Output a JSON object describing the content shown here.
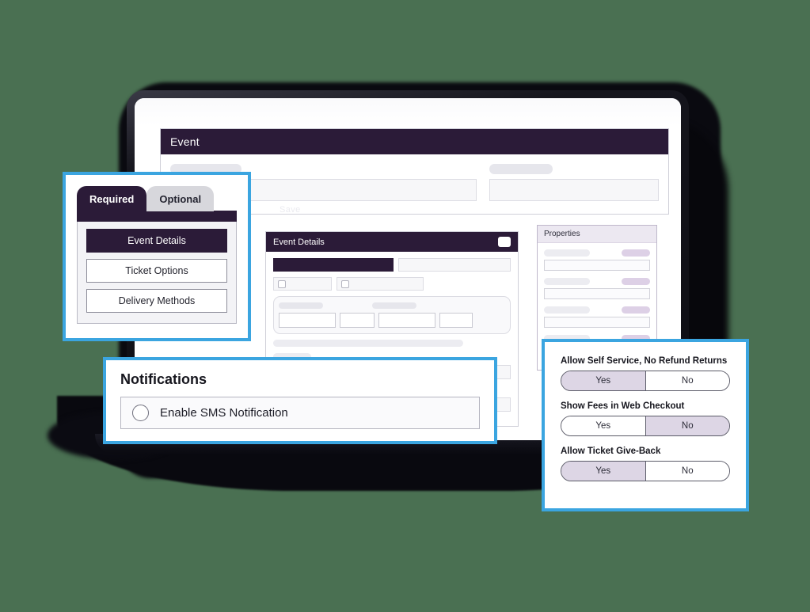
{
  "theme": {
    "background": "#4a7052",
    "accent_blue": "#3ba5e0",
    "brand_purple": "#2b1b38",
    "toggle_selected": "#ddd6e5"
  },
  "app": {
    "event_card": {
      "header_title": "Event",
      "ghost_button_label": "Save"
    },
    "details_card": {
      "header_title": "Event Details"
    },
    "properties_card": {
      "header_title": "Properties"
    }
  },
  "tabs_panel": {
    "tabs": [
      {
        "label": "Required",
        "active": true
      },
      {
        "label": "Optional",
        "active": false
      }
    ],
    "nav_buttons": [
      {
        "label": "Event Details",
        "active": true
      },
      {
        "label": "Ticket Options",
        "active": false
      },
      {
        "label": "Delivery Methods",
        "active": false
      }
    ]
  },
  "notifications_panel": {
    "title": "Notifications",
    "items": [
      {
        "label": "Enable SMS Notification",
        "selected": false
      }
    ]
  },
  "toggle_panel": {
    "groups": [
      {
        "title": "Allow Self Service, No Refund Returns",
        "options": [
          "Yes",
          "No"
        ],
        "selected": "Yes"
      },
      {
        "title": "Show Fees in Web Checkout",
        "options": [
          "Yes",
          "No"
        ],
        "selected": "No"
      },
      {
        "title": "Allow Ticket Give-Back",
        "options": [
          "Yes",
          "No"
        ],
        "selected": "Yes"
      }
    ]
  }
}
